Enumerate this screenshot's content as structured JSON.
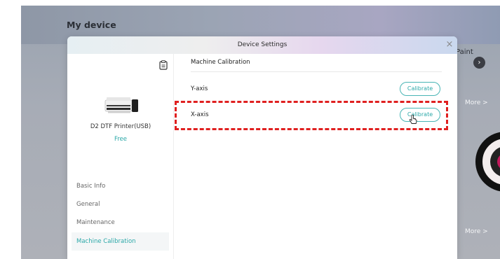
{
  "page": {
    "title": "My device"
  },
  "background": {
    "paint_label": "Paint",
    "more_label_1": "More >",
    "more_label_2": "More >"
  },
  "modal": {
    "title": "Device Settings",
    "close_symbol": "×"
  },
  "device": {
    "name": "D2 DTF Printer(USB)",
    "status": "Free",
    "icons": {
      "clipboard": "clipboard-icon",
      "printer": "printer-icon"
    }
  },
  "nav": {
    "items": [
      {
        "label": "Basic Info",
        "active": false
      },
      {
        "label": "General",
        "active": false
      },
      {
        "label": "Maintenance",
        "active": false
      },
      {
        "label": "Machine Calibration",
        "active": true
      }
    ]
  },
  "calibration": {
    "section_title": "Machine Calibration",
    "rows": [
      {
        "label": "Y-axis",
        "button_label": "Calibrate"
      },
      {
        "label": "X-axis",
        "button_label": "Calibrate",
        "highlighted": true
      }
    ]
  },
  "colors": {
    "accent": "#2ba8a8",
    "highlight": "#e02020"
  }
}
